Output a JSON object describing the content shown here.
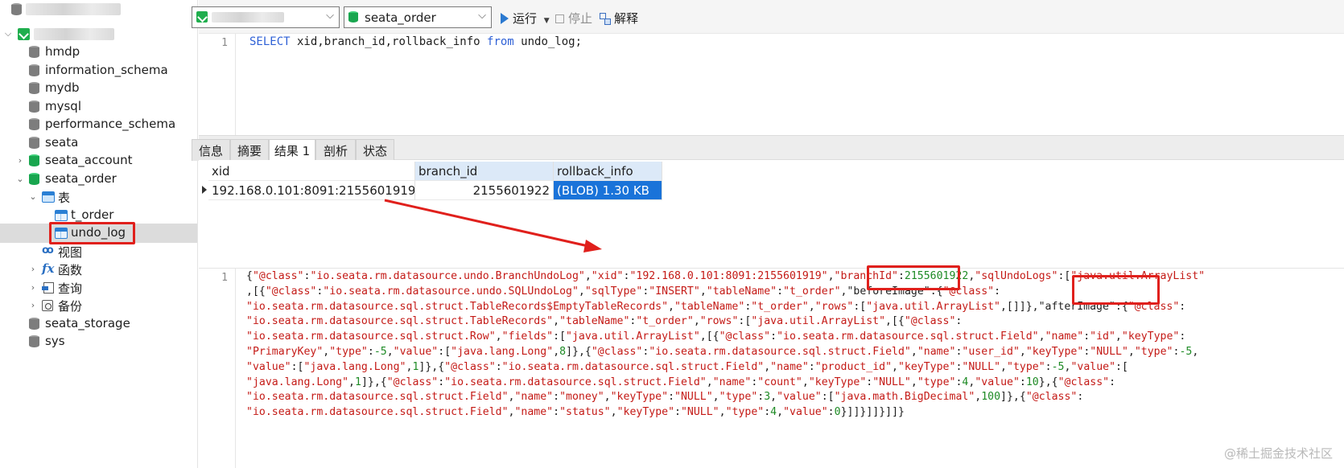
{
  "sidebar": {
    "items": [
      {
        "label": "hmdp"
      },
      {
        "label": "information_schema"
      },
      {
        "label": "mydb"
      },
      {
        "label": "mysql"
      },
      {
        "label": "performance_schema"
      },
      {
        "label": "seata"
      },
      {
        "label": "seata_account"
      },
      {
        "label": "seata_order"
      },
      {
        "label": "表"
      },
      {
        "label": "t_order"
      },
      {
        "label": "undo_log"
      },
      {
        "label": "视图"
      },
      {
        "label": "函数"
      },
      {
        "label": "查询"
      },
      {
        "label": "备份"
      },
      {
        "label": "seata_storage"
      },
      {
        "label": "sys"
      }
    ]
  },
  "toolbar": {
    "database": "seata_order",
    "run_label": "运行",
    "stop_label": "停止",
    "explain_label": "解释"
  },
  "editor": {
    "line_no": "1",
    "kw_select": "SELECT",
    "columns": " xid,branch_id,rollback_info ",
    "kw_from": "from",
    "table": " undo_log;"
  },
  "tabs": [
    {
      "label": "信息"
    },
    {
      "label": "摘要"
    },
    {
      "label": "结果 1"
    },
    {
      "label": "剖析"
    },
    {
      "label": "状态"
    }
  ],
  "grid": {
    "columns": [
      "xid",
      "branch_id",
      "rollback_info"
    ],
    "rows": [
      {
        "xid": "192.168.0.101:8091:2155601919",
        "branch_id": "2155601922",
        "rollback_info": "(BLOB) 1.30 KB"
      }
    ]
  },
  "viewer": {
    "line_no": "1",
    "lines": [
      [
        [
          "p",
          "{"
        ],
        [
          "s",
          "\"@class\""
        ],
        [
          "p",
          ":"
        ],
        [
          "s",
          "\"io.seata.rm.datasource.undo.BranchUndoLog\""
        ],
        [
          "p",
          ","
        ],
        [
          "s",
          "\"xid\""
        ],
        [
          "p",
          ":"
        ],
        [
          "s",
          "\"192.168.0.101:8091:2155601919\""
        ],
        [
          "p",
          ","
        ],
        [
          "s",
          "\"branchId\""
        ],
        [
          "p",
          ":"
        ],
        [
          "n",
          "2155601922"
        ],
        [
          "p",
          ","
        ],
        [
          "s",
          "\"sqlUndoLogs\""
        ],
        [
          "p",
          ":["
        ],
        [
          "s",
          "\"java.util.ArrayList\""
        ]
      ],
      [
        [
          "p",
          ",[{"
        ],
        [
          "s",
          "\"@class\""
        ],
        [
          "p",
          ":"
        ],
        [
          "s",
          "\"io.seata.rm.datasource.undo.SQLUndoLog\""
        ],
        [
          "p",
          ","
        ],
        [
          "s",
          "\"sqlType\""
        ],
        [
          "p",
          ":"
        ],
        [
          "s",
          "\"INSERT\""
        ],
        [
          "p",
          ","
        ],
        [
          "s",
          "\"tableName\""
        ],
        [
          "p",
          ":"
        ],
        [
          "s",
          "\"t_order\""
        ],
        [
          "p",
          ","
        ],
        [
          "p",
          "\"beforeImage\""
        ],
        [
          "p",
          ":{"
        ],
        [
          "s",
          "\"@class\""
        ],
        [
          "p",
          ":"
        ]
      ],
      [
        [
          "s",
          "\"io.seata.rm.datasource.sql.struct.TableRecords$EmptyTableRecords\""
        ],
        [
          "p",
          ","
        ],
        [
          "s",
          "\"tableName\""
        ],
        [
          "p",
          ":"
        ],
        [
          "s",
          "\"t_order\""
        ],
        [
          "p",
          ","
        ],
        [
          "s",
          "\"rows\""
        ],
        [
          "p",
          ":["
        ],
        [
          "s",
          "\"java.util.ArrayList\""
        ],
        [
          "p",
          ",[]]},"
        ],
        [
          "p",
          "\"afterImage\""
        ],
        [
          "p",
          ":{"
        ],
        [
          "s",
          "\"@class\""
        ],
        [
          "p",
          ":"
        ]
      ],
      [
        [
          "s",
          "\"io.seata.rm.datasource.sql.struct.TableRecords\""
        ],
        [
          "p",
          ","
        ],
        [
          "s",
          "\"tableName\""
        ],
        [
          "p",
          ":"
        ],
        [
          "s",
          "\"t_order\""
        ],
        [
          "p",
          ","
        ],
        [
          "s",
          "\"rows\""
        ],
        [
          "p",
          ":["
        ],
        [
          "s",
          "\"java.util.ArrayList\""
        ],
        [
          "p",
          ",[{"
        ],
        [
          "s",
          "\"@class\""
        ],
        [
          "p",
          ":"
        ]
      ],
      [
        [
          "s",
          "\"io.seata.rm.datasource.sql.struct.Row\""
        ],
        [
          "p",
          ","
        ],
        [
          "s",
          "\"fields\""
        ],
        [
          "p",
          ":["
        ],
        [
          "s",
          "\"java.util.ArrayList\""
        ],
        [
          "p",
          ",[{"
        ],
        [
          "s",
          "\"@class\""
        ],
        [
          "p",
          ":"
        ],
        [
          "s",
          "\"io.seata.rm.datasource.sql.struct.Field\""
        ],
        [
          "p",
          ","
        ],
        [
          "s",
          "\"name\""
        ],
        [
          "p",
          ":"
        ],
        [
          "s",
          "\"id\""
        ],
        [
          "p",
          ","
        ],
        [
          "s",
          "\"keyType\""
        ],
        [
          "p",
          ":"
        ]
      ],
      [
        [
          "s",
          "\"PrimaryKey\""
        ],
        [
          "p",
          ","
        ],
        [
          "s",
          "\"type\""
        ],
        [
          "p",
          ":"
        ],
        [
          "n",
          "-5"
        ],
        [
          "p",
          ","
        ],
        [
          "s",
          "\"value\""
        ],
        [
          "p",
          ":["
        ],
        [
          "s",
          "\"java.lang.Long\""
        ],
        [
          "p",
          ","
        ],
        [
          "n",
          "8"
        ],
        [
          "p",
          "]},{"
        ],
        [
          "s",
          "\"@class\""
        ],
        [
          "p",
          ":"
        ],
        [
          "s",
          "\"io.seata.rm.datasource.sql.struct.Field\""
        ],
        [
          "p",
          ","
        ],
        [
          "s",
          "\"name\""
        ],
        [
          "p",
          ":"
        ],
        [
          "s",
          "\"user_id\""
        ],
        [
          "p",
          ","
        ],
        [
          "s",
          "\"keyType\""
        ],
        [
          "p",
          ":"
        ],
        [
          "s",
          "\"NULL\""
        ],
        [
          "p",
          ","
        ],
        [
          "s",
          "\"type\""
        ],
        [
          "p",
          ":"
        ],
        [
          "n",
          "-5"
        ],
        [
          "p",
          ","
        ]
      ],
      [
        [
          "s",
          "\"value\""
        ],
        [
          "p",
          ":["
        ],
        [
          "s",
          "\"java.lang.Long\""
        ],
        [
          "p",
          ","
        ],
        [
          "n",
          "1"
        ],
        [
          "p",
          "]},{"
        ],
        [
          "s",
          "\"@class\""
        ],
        [
          "p",
          ":"
        ],
        [
          "s",
          "\"io.seata.rm.datasource.sql.struct.Field\""
        ],
        [
          "p",
          ","
        ],
        [
          "s",
          "\"name\""
        ],
        [
          "p",
          ":"
        ],
        [
          "s",
          "\"product_id\""
        ],
        [
          "p",
          ","
        ],
        [
          "s",
          "\"keyType\""
        ],
        [
          "p",
          ":"
        ],
        [
          "s",
          "\"NULL\""
        ],
        [
          "p",
          ","
        ],
        [
          "s",
          "\"type\""
        ],
        [
          "p",
          ":"
        ],
        [
          "n",
          "-5"
        ],
        [
          "p",
          ","
        ],
        [
          "s",
          "\"value\""
        ],
        [
          "p",
          ":["
        ]
      ],
      [
        [
          "s",
          "\"java.lang.Long\""
        ],
        [
          "p",
          ","
        ],
        [
          "n",
          "1"
        ],
        [
          "p",
          "]},{"
        ],
        [
          "s",
          "\"@class\""
        ],
        [
          "p",
          ":"
        ],
        [
          "s",
          "\"io.seata.rm.datasource.sql.struct.Field\""
        ],
        [
          "p",
          ","
        ],
        [
          "s",
          "\"name\""
        ],
        [
          "p",
          ":"
        ],
        [
          "s",
          "\"count\""
        ],
        [
          "p",
          ","
        ],
        [
          "s",
          "\"keyType\""
        ],
        [
          "p",
          ":"
        ],
        [
          "s",
          "\"NULL\""
        ],
        [
          "p",
          ","
        ],
        [
          "s",
          "\"type\""
        ],
        [
          "p",
          ":"
        ],
        [
          "n",
          "4"
        ],
        [
          "p",
          ","
        ],
        [
          "s",
          "\"value\""
        ],
        [
          "p",
          ":"
        ],
        [
          "n",
          "10"
        ],
        [
          "p",
          "},{"
        ],
        [
          "s",
          "\"@class\""
        ],
        [
          "p",
          ":"
        ]
      ],
      [
        [
          "s",
          "\"io.seata.rm.datasource.sql.struct.Field\""
        ],
        [
          "p",
          ","
        ],
        [
          "s",
          "\"name\""
        ],
        [
          "p",
          ":"
        ],
        [
          "s",
          "\"money\""
        ],
        [
          "p",
          ","
        ],
        [
          "s",
          "\"keyType\""
        ],
        [
          "p",
          ":"
        ],
        [
          "s",
          "\"NULL\""
        ],
        [
          "p",
          ","
        ],
        [
          "s",
          "\"type\""
        ],
        [
          "p",
          ":"
        ],
        [
          "n",
          "3"
        ],
        [
          "p",
          ","
        ],
        [
          "s",
          "\"value\""
        ],
        [
          "p",
          ":["
        ],
        [
          "s",
          "\"java.math.BigDecimal\""
        ],
        [
          "p",
          ","
        ],
        [
          "n",
          "100"
        ],
        [
          "p",
          "]},{"
        ],
        [
          "s",
          "\"@class\""
        ],
        [
          "p",
          ":"
        ]
      ],
      [
        [
          "s",
          "\"io.seata.rm.datasource.sql.struct.Field\""
        ],
        [
          "p",
          ","
        ],
        [
          "s",
          "\"name\""
        ],
        [
          "p",
          ":"
        ],
        [
          "s",
          "\"status\""
        ],
        [
          "p",
          ","
        ],
        [
          "s",
          "\"keyType\""
        ],
        [
          "p",
          ":"
        ],
        [
          "s",
          "\"NULL\""
        ],
        [
          "p",
          ","
        ],
        [
          "s",
          "\"type\""
        ],
        [
          "p",
          ":"
        ],
        [
          "n",
          "4"
        ],
        [
          "p",
          ","
        ],
        [
          "s",
          "\"value\""
        ],
        [
          "p",
          ":"
        ],
        [
          "n",
          "0"
        ],
        [
          "p",
          "}]]}]]}]]}"
        ]
      ]
    ]
  },
  "watermark": "@稀土掘金技术社区",
  "colors": {
    "keyword": "#2f61d6",
    "string": "#c41a16",
    "number": "#1d8a24",
    "selection": "#1a73d9",
    "annotation": "#e0201c"
  }
}
